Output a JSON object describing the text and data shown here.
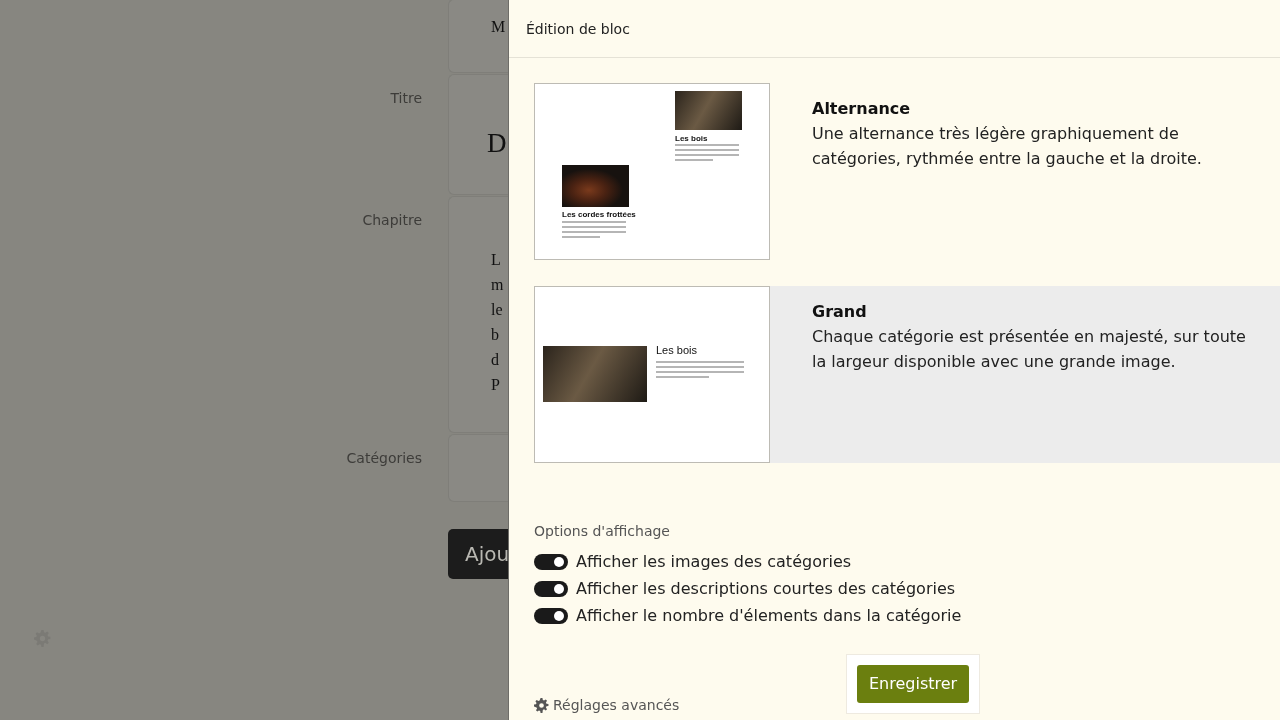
{
  "background_form": {
    "top_card_lines": [
      "M"
    ],
    "fields": [
      {
        "label": "Titre",
        "kind": "title",
        "lines": [
          "D"
        ]
      },
      {
        "label": "Chapitre",
        "kind": "text",
        "lines": [
          "L",
          "m",
          "le",
          "b",
          "d",
          "P"
        ]
      },
      {
        "label": "Catégories",
        "kind": "empty"
      }
    ],
    "submit_button": "Ajou"
  },
  "panel": {
    "title": "Édition de bloc",
    "layouts": [
      {
        "kind": "alternance",
        "name": "Alternance",
        "description": "Une alternance très légère graphiquement de catégories, rythmée entre la gauche et la droite.",
        "selected": false,
        "preview_headings": [
          "Les bois",
          "Les cordes frottées"
        ]
      },
      {
        "kind": "grand",
        "name": "Grand",
        "description": "Chaque catégorie est présentée en majesté, sur toute la largeur disponible avec une grande image.",
        "selected": true,
        "preview_headings": [
          "Les bois"
        ]
      }
    ],
    "options_title": "Options d'affichage",
    "options": [
      {
        "label": "Afficher les images des catégories",
        "on": true
      },
      {
        "label": "Afficher les descriptions courtes des catégories",
        "on": true
      },
      {
        "label": "Afficher le nombre d'élements dans la catégorie",
        "on": true
      }
    ],
    "save_button": "Enregistrer",
    "advanced_link": "Réglages avancés"
  }
}
